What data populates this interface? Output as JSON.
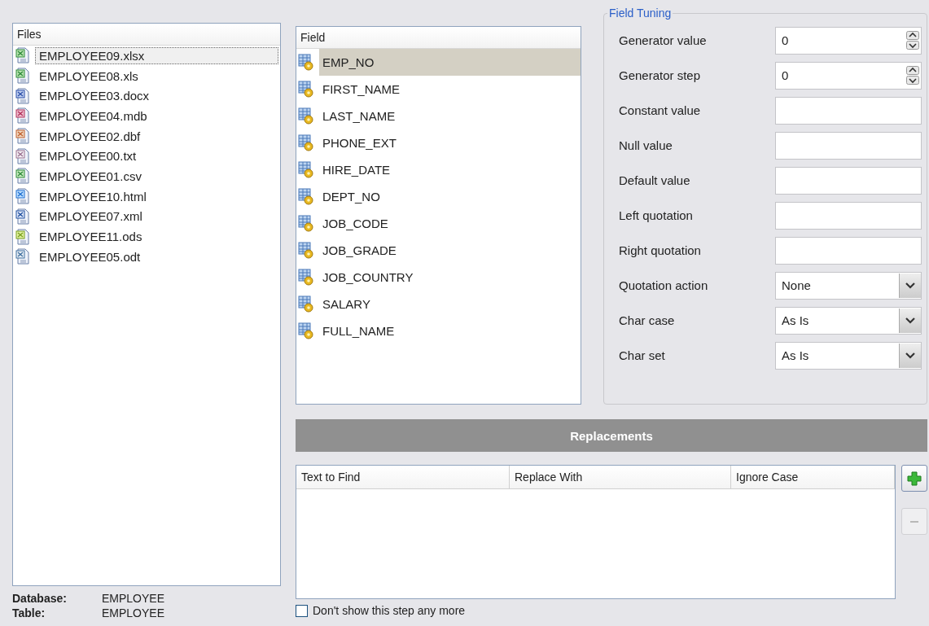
{
  "files": {
    "header": "Files",
    "items": [
      {
        "name": "EMPLOYEE09.xlsx",
        "kind": "excel",
        "selected": true
      },
      {
        "name": "EMPLOYEE08.xls",
        "kind": "excel",
        "selected": false
      },
      {
        "name": "EMPLOYEE03.docx",
        "kind": "word",
        "selected": false
      },
      {
        "name": "EMPLOYEE04.mdb",
        "kind": "access",
        "selected": false
      },
      {
        "name": "EMPLOYEE02.dbf",
        "kind": "dbf",
        "selected": false
      },
      {
        "name": "EMPLOYEE00.txt",
        "kind": "text",
        "selected": false
      },
      {
        "name": "EMPLOYEE01.csv",
        "kind": "csv",
        "selected": false
      },
      {
        "name": "EMPLOYEE10.html",
        "kind": "html",
        "selected": false
      },
      {
        "name": "EMPLOYEE07.xml",
        "kind": "xml",
        "selected": false
      },
      {
        "name": "EMPLOYEE11.ods",
        "kind": "ods",
        "selected": false
      },
      {
        "name": "EMPLOYEE05.odt",
        "kind": "odt",
        "selected": false
      }
    ]
  },
  "info": [
    {
      "label": "Database:",
      "value": "EMPLOYEE"
    },
    {
      "label": "Table:",
      "value": "EMPLOYEE"
    }
  ],
  "fields": {
    "header": "Field",
    "items": [
      {
        "name": "EMP_NO",
        "selected": true
      },
      {
        "name": "FIRST_NAME",
        "selected": false
      },
      {
        "name": "LAST_NAME",
        "selected": false
      },
      {
        "name": "PHONE_EXT",
        "selected": false
      },
      {
        "name": "HIRE_DATE",
        "selected": false
      },
      {
        "name": "DEPT_NO",
        "selected": false
      },
      {
        "name": "JOB_CODE",
        "selected": false
      },
      {
        "name": "JOB_GRADE",
        "selected": false
      },
      {
        "name": "JOB_COUNTRY",
        "selected": false
      },
      {
        "name": "SALARY",
        "selected": false
      },
      {
        "name": "FULL_NAME",
        "selected": false
      }
    ]
  },
  "field_tuning": {
    "title": "Field Tuning",
    "rows": [
      {
        "label": "Generator value",
        "kind": "spin",
        "value": "0"
      },
      {
        "label": "Generator step",
        "kind": "spin",
        "value": "0"
      },
      {
        "label": "Constant value",
        "kind": "text"
      },
      {
        "label": "Null value",
        "kind": "text"
      },
      {
        "label": "Default value",
        "kind": "text"
      },
      {
        "label": "Left quotation",
        "kind": "text"
      },
      {
        "label": "Right quotation",
        "kind": "text"
      },
      {
        "label": "Quotation action",
        "kind": "combo",
        "value": "None"
      },
      {
        "label": "Char case",
        "kind": "combo",
        "value": "As Is"
      },
      {
        "label": "Char set",
        "kind": "combo",
        "value": "As Is"
      }
    ]
  },
  "replacements": {
    "title": "Replacements",
    "columns": [
      "Text to Find",
      "Replace With",
      "Ignore Case"
    ],
    "add_disabled": false,
    "remove_disabled": true
  },
  "dont_show": {
    "label": "Don't show this step any more",
    "checked": false
  }
}
